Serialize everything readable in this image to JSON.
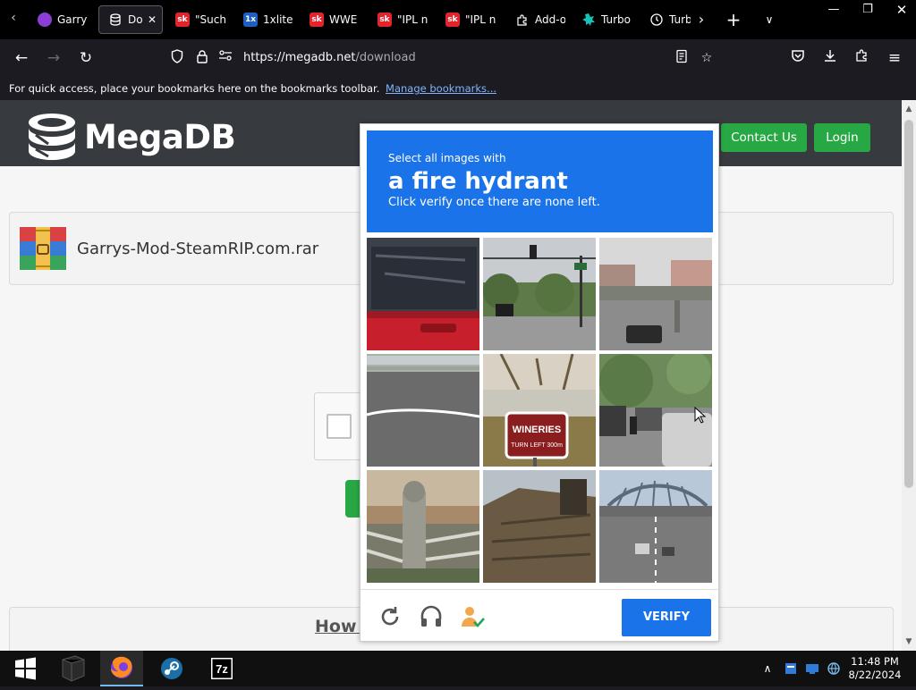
{
  "browser": {
    "tabs": [
      {
        "title": "Garry",
        "favicon": "purple-gem-icon",
        "color": "#8b3dd6",
        "active": false
      },
      {
        "title": "Do",
        "favicon": "database-icon",
        "color": "#1c1b22",
        "active": true,
        "close": "✕"
      },
      {
        "title": "\"Such",
        "favicon": "sk-icon",
        "color": "#e3242b",
        "active": false
      },
      {
        "title": "1xlite",
        "favicon": "1x-icon",
        "color": "#1f5fbf",
        "active": false
      },
      {
        "title": "WWE",
        "favicon": "sk-icon",
        "color": "#e3242b",
        "active": false
      },
      {
        "title": "\"IPL n",
        "favicon": "sk-icon",
        "color": "#e3242b",
        "active": false
      },
      {
        "title": "\"IPL n",
        "favicon": "sk-icon",
        "color": "#e3242b",
        "active": false
      },
      {
        "title": "Add-o",
        "favicon": "puzzle-icon",
        "color": "#000000",
        "active": false
      },
      {
        "title": "Turbo",
        "favicon": "turbo-icon",
        "color": "#17c2b8",
        "active": false
      },
      {
        "title": "Turb",
        "favicon": "clock-icon",
        "color": "#000000",
        "active": false
      }
    ],
    "url_host": "https://megadb.net",
    "url_path": "/download",
    "bookmarks_text": "For quick access, place your bookmarks here on the bookmarks toolbar.",
    "bookmarks_link": "Manage bookmarks..."
  },
  "site": {
    "logo_text": "MegaDB",
    "contact_label": "Contact Us",
    "login_label": "Login",
    "file_name": "Garrys-Mod-SteamRIP.com.rar",
    "how_title": "How t",
    "accent_green": "#27a844"
  },
  "captcha": {
    "prompt_pre": "Select all images with",
    "target": "a fire hydrant",
    "prompt_post": "Click verify once there are none left.",
    "verify_label": "VERIFY",
    "tiles": [
      {
        "scene": "red car rear window"
      },
      {
        "scene": "traffic lights and street"
      },
      {
        "scene": "overpass with truck"
      },
      {
        "scene": "road and guardrail"
      },
      {
        "scene": "wineries road sign",
        "sign_line1": "WINERIES",
        "sign_line2": "TURN LEFT 300m"
      },
      {
        "scene": "street with cars and motorbike"
      },
      {
        "scene": "stone gate pillar"
      },
      {
        "scene": "rooftop"
      },
      {
        "scene": "highway bridge"
      }
    ],
    "accent": "#1a73e8"
  },
  "taskbar": {
    "apps": [
      "start-icon",
      "terminal-icon",
      "firefox-icon",
      "steam-icon",
      "7zip-icon"
    ],
    "sevenzip_label": "7z",
    "time": "11:48 PM",
    "date": "8/22/2024"
  }
}
